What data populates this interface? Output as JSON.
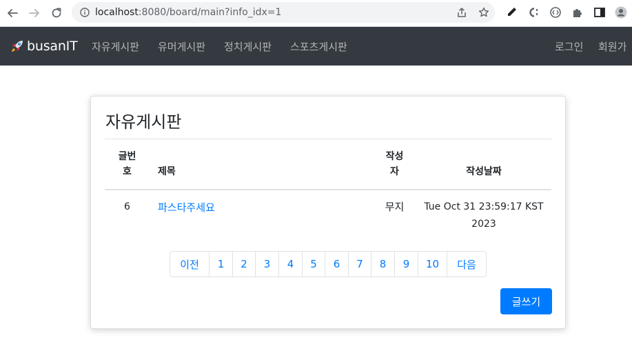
{
  "browser": {
    "url_host": "localhost",
    "url_rest": ":8080/board/main?info_idx=1"
  },
  "navbar": {
    "brand": "busanIT",
    "menu": [
      "자유게시판",
      "유머게시판",
      "정치게시판",
      "스포츠게시판"
    ],
    "login": "로그인",
    "signup": "회원가"
  },
  "board": {
    "title": "자유게시판",
    "columns": {
      "no_line1": "글번",
      "no_line2": "호",
      "subject": "제목",
      "author_line1": "작성",
      "author_line2": "자",
      "date": "작성날짜"
    },
    "rows": [
      {
        "no": "6",
        "subject": "파스타주세요",
        "author": "무지",
        "date_line1": "Tue Oct 31 23:59:17 KST",
        "date_line2": "2023"
      }
    ],
    "pagination": [
      "이전",
      "1",
      "2",
      "3",
      "4",
      "5",
      "6",
      "7",
      "8",
      "9",
      "10",
      "다음"
    ],
    "write_button": "글쓰기"
  },
  "colors": {
    "navbar_bg": "#343a40",
    "primary": "#007bff"
  }
}
